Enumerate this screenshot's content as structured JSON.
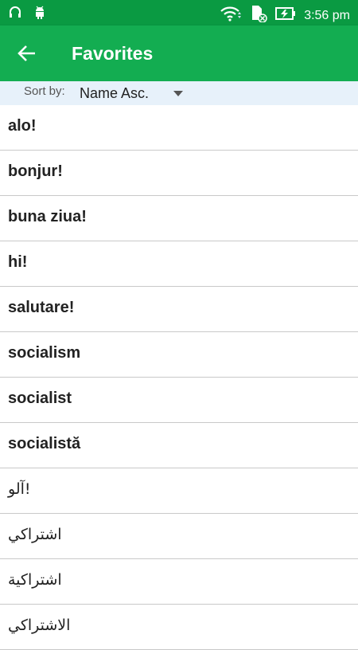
{
  "status_bar": {
    "time": "3:56 pm",
    "left_icons": [
      "headphones-icon",
      "android-icon"
    ],
    "right_icons": [
      "wifi-icon",
      "sd-card-icon",
      "battery-charging-icon"
    ]
  },
  "app_bar": {
    "title": "Favorites",
    "back_icon": "arrow-left-icon",
    "color": "#13ad51",
    "status_color": "#0a9a42"
  },
  "sort": {
    "label": "Sort by:",
    "value": "Name Asc."
  },
  "favorites": [
    {
      "text": "alo!"
    },
    {
      "text": "bonjur!"
    },
    {
      "text": "buna ziua!"
    },
    {
      "text": "hi!"
    },
    {
      "text": "salutare!"
    },
    {
      "text": "socialism"
    },
    {
      "text": "socialist"
    },
    {
      "text": "socialistă"
    },
    {
      "text": "آلو!"
    },
    {
      "text": "اشتراكي"
    },
    {
      "text": "اشتراكية"
    },
    {
      "text": "الاشتراكي"
    }
  ]
}
